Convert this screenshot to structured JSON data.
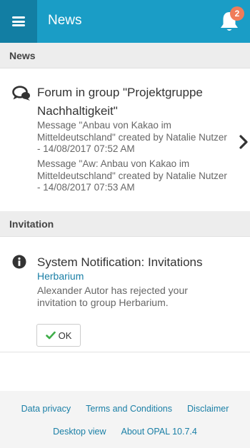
{
  "header": {
    "title": "News",
    "notification_count": "2",
    "menu_icon": "hamburger-menu-icon",
    "bell_icon": "bell-icon"
  },
  "sections": {
    "news_label": "News",
    "invitation_label": "Invitation"
  },
  "news_item": {
    "icon": "forum-chat-icon",
    "title": "Forum in group \"Projektgruppe Nachhaltigkeit\"",
    "messages": [
      "Message \"Anbau von Kakao im Mitteldeutschland\" created by Natalie Nutzer - 14/08/2017 07:52 AM",
      "Message \"Aw: Anbau von Kakao im Mitteldeutschland\" created by Natalie Nutzer - 14/08/2017 07:53 AM"
    ]
  },
  "invitation": {
    "icon": "info-icon",
    "title": "System Notification: Invitations",
    "group_link": "Herbarium",
    "text": "Alexander Autor has rejected your invitation to group Herbarium.",
    "ok_label": "OK"
  },
  "footer": {
    "links_row1": [
      "Data privacy",
      "Terms and Conditions",
      "Disclaimer"
    ],
    "links_row2": [
      "Desktop view",
      "About OPAL 10.7.4"
    ]
  },
  "colors": {
    "header_bg": "#1a9dc6",
    "menu_bg": "#127ea3",
    "badge_bg": "#f07c5a",
    "link": "#1a7fa6",
    "check_green": "#3fae49"
  }
}
